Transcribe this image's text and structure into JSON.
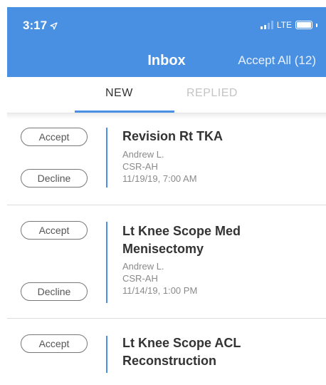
{
  "status_bar": {
    "time": "3:17",
    "network": "LTE"
  },
  "header": {
    "title": "Inbox",
    "accept_all": "Accept All (12)"
  },
  "tabs": [
    {
      "label": "NEW",
      "active": true
    },
    {
      "label": "REPLIED",
      "active": false
    }
  ],
  "colors": {
    "accent": "#4a90e2"
  },
  "items": [
    {
      "accept_label": "Accept",
      "decline_label": "Decline",
      "title_lines": [
        "Revision Rt TKA"
      ],
      "name": "Andrew  L.",
      "location": "CSR-AH",
      "datetime": "11/19/19, 7:00 AM"
    },
    {
      "accept_label": "Accept",
      "decline_label": "Decline",
      "title_lines": [
        "Lt Knee Scope Med",
        "Menisectomy"
      ],
      "name": "Andrew  L.",
      "location": "CSR-AH",
      "datetime": "11/14/19, 1:00 PM"
    },
    {
      "accept_label": "Accept",
      "title_lines": [
        "Lt Knee Scope ACL",
        "Reconstruction"
      ]
    }
  ]
}
